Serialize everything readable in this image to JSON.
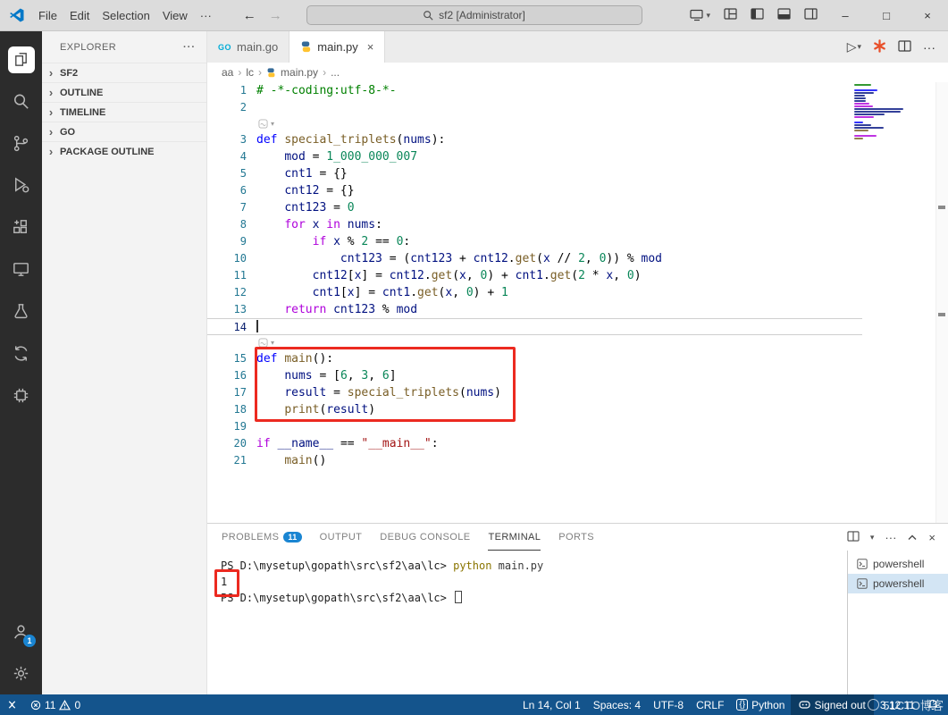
{
  "titlebar": {
    "menus": [
      "File",
      "Edit",
      "Selection",
      "View",
      "···"
    ],
    "search_text": "sf2 [Administrator]",
    "nav": {
      "back": "←",
      "forward": "→"
    },
    "window_controls": {
      "minimize": "–",
      "maximize": "□",
      "close": "×"
    }
  },
  "icons": {
    "caret": "▾",
    "more": "···",
    "chevron": "›",
    "breadcrumb_sep": "›",
    "play": "▷",
    "close_tab": "×",
    "close": "×",
    "go_logo": "GO",
    "language_braces": "{}"
  },
  "activity_bar": {
    "account_badge": "1"
  },
  "sidebar": {
    "title": "EXPLORER",
    "sections": [
      "SF2",
      "OUTLINE",
      "TIMELINE",
      "GO",
      "PACKAGE OUTLINE"
    ]
  },
  "editor": {
    "tabs": [
      {
        "label": "main.go",
        "icon": "go-icon"
      },
      {
        "label": "main.py",
        "icon": "python-icon",
        "active": true
      }
    ],
    "breadcrumb": [
      "aa",
      "lc",
      "main.py",
      "..."
    ],
    "cursor_line": 14,
    "lines": [
      {
        "n": 1,
        "tokens": [
          [
            "com",
            "# -*-coding:utf-8-*-"
          ]
        ]
      },
      {
        "n": 2,
        "tokens": []
      },
      {
        "adorn": true
      },
      {
        "n": 3,
        "tokens": [
          [
            "kw",
            "def "
          ],
          [
            "fn",
            "special_triplets"
          ],
          [
            "op",
            "("
          ],
          [
            "var",
            "nums"
          ],
          [
            "op",
            "):"
          ]
        ]
      },
      {
        "n": 4,
        "tokens": [
          [
            "txt",
            "    "
          ],
          [
            "var",
            "mod"
          ],
          [
            "op",
            " = "
          ],
          [
            "num",
            "1_000_000_007"
          ]
        ]
      },
      {
        "n": 5,
        "tokens": [
          [
            "txt",
            "    "
          ],
          [
            "var",
            "cnt1"
          ],
          [
            "op",
            " = {}"
          ]
        ]
      },
      {
        "n": 6,
        "tokens": [
          [
            "txt",
            "    "
          ],
          [
            "var",
            "cnt12"
          ],
          [
            "op",
            " = {}"
          ]
        ]
      },
      {
        "n": 7,
        "tokens": [
          [
            "txt",
            "    "
          ],
          [
            "var",
            "cnt123"
          ],
          [
            "op",
            " = "
          ],
          [
            "num",
            "0"
          ]
        ]
      },
      {
        "n": 8,
        "tokens": [
          [
            "txt",
            "    "
          ],
          [
            "ctrl",
            "for"
          ],
          [
            "var",
            " x "
          ],
          [
            "ctrl",
            "in"
          ],
          [
            "var",
            " nums"
          ],
          [
            "op",
            ":"
          ]
        ]
      },
      {
        "n": 9,
        "tokens": [
          [
            "txt",
            "        "
          ],
          [
            "ctrl",
            "if"
          ],
          [
            "var",
            " x "
          ],
          [
            "op",
            "% "
          ],
          [
            "num",
            "2"
          ],
          [
            "op",
            " == "
          ],
          [
            "num",
            "0"
          ],
          [
            "op",
            ":"
          ]
        ]
      },
      {
        "n": 10,
        "tokens": [
          [
            "txt",
            "            "
          ],
          [
            "var",
            "cnt123"
          ],
          [
            "op",
            " = ("
          ],
          [
            "var",
            "cnt123"
          ],
          [
            "op",
            " + "
          ],
          [
            "var",
            "cnt12"
          ],
          [
            "op",
            "."
          ],
          [
            "fn",
            "get"
          ],
          [
            "op",
            "("
          ],
          [
            "var",
            "x"
          ],
          [
            "op",
            " // "
          ],
          [
            "num",
            "2"
          ],
          [
            "op",
            ", "
          ],
          [
            "num",
            "0"
          ],
          [
            "op",
            ")) % "
          ],
          [
            "var",
            "mod"
          ]
        ]
      },
      {
        "n": 11,
        "tokens": [
          [
            "txt",
            "        "
          ],
          [
            "var",
            "cnt12"
          ],
          [
            "op",
            "["
          ],
          [
            "var",
            "x"
          ],
          [
            "op",
            "] = "
          ],
          [
            "var",
            "cnt12"
          ],
          [
            "op",
            "."
          ],
          [
            "fn",
            "get"
          ],
          [
            "op",
            "("
          ],
          [
            "var",
            "x"
          ],
          [
            "op",
            ", "
          ],
          [
            "num",
            "0"
          ],
          [
            "op",
            ") + "
          ],
          [
            "var",
            "cnt1"
          ],
          [
            "op",
            "."
          ],
          [
            "fn",
            "get"
          ],
          [
            "op",
            "("
          ],
          [
            "num",
            "2"
          ],
          [
            "op",
            " * "
          ],
          [
            "var",
            "x"
          ],
          [
            "op",
            ", "
          ],
          [
            "num",
            "0"
          ],
          [
            "op",
            ")"
          ]
        ]
      },
      {
        "n": 12,
        "tokens": [
          [
            "txt",
            "        "
          ],
          [
            "var",
            "cnt1"
          ],
          [
            "op",
            "["
          ],
          [
            "var",
            "x"
          ],
          [
            "op",
            "] = "
          ],
          [
            "var",
            "cnt1"
          ],
          [
            "op",
            "."
          ],
          [
            "fn",
            "get"
          ],
          [
            "op",
            "("
          ],
          [
            "var",
            "x"
          ],
          [
            "op",
            ", "
          ],
          [
            "num",
            "0"
          ],
          [
            "op",
            ") + "
          ],
          [
            "num",
            "1"
          ]
        ]
      },
      {
        "n": 13,
        "tokens": [
          [
            "txt",
            "    "
          ],
          [
            "ctrl",
            "return"
          ],
          [
            "var",
            " cnt123 "
          ],
          [
            "op",
            "% "
          ],
          [
            "var",
            "mod"
          ]
        ]
      },
      {
        "n": 14,
        "tokens": []
      },
      {
        "adorn": true
      },
      {
        "n": 15,
        "tokens": [
          [
            "kw",
            "def "
          ],
          [
            "fn",
            "main"
          ],
          [
            "op",
            "():"
          ]
        ]
      },
      {
        "n": 16,
        "tokens": [
          [
            "txt",
            "    "
          ],
          [
            "var",
            "nums"
          ],
          [
            "op",
            " = ["
          ],
          [
            "num",
            "6"
          ],
          [
            "op",
            ", "
          ],
          [
            "num",
            "3"
          ],
          [
            "op",
            ", "
          ],
          [
            "num",
            "6"
          ],
          [
            "op",
            "]"
          ]
        ]
      },
      {
        "n": 17,
        "tokens": [
          [
            "txt",
            "    "
          ],
          [
            "var",
            "result"
          ],
          [
            "op",
            " = "
          ],
          [
            "fn",
            "special_triplets"
          ],
          [
            "op",
            "("
          ],
          [
            "var",
            "nums"
          ],
          [
            "op",
            ")"
          ]
        ]
      },
      {
        "n": 18,
        "tokens": [
          [
            "txt",
            "    "
          ],
          [
            "fn",
            "print"
          ],
          [
            "op",
            "("
          ],
          [
            "var",
            "result"
          ],
          [
            "op",
            ")"
          ]
        ]
      },
      {
        "n": 19,
        "tokens": []
      },
      {
        "n": 20,
        "tokens": [
          [
            "ctrl",
            "if"
          ],
          [
            "var",
            " __name__ "
          ],
          [
            "op",
            "== "
          ],
          [
            "str",
            "\"__main__\""
          ],
          [
            "op",
            ":"
          ]
        ]
      },
      {
        "n": 21,
        "tokens": [
          [
            "txt",
            "    "
          ],
          [
            "fn",
            "main"
          ],
          [
            "op",
            "()"
          ]
        ]
      }
    ]
  },
  "panel": {
    "tabs": [
      {
        "label": "PROBLEMS",
        "badge": "11"
      },
      {
        "label": "OUTPUT"
      },
      {
        "label": "DEBUG CONSOLE"
      },
      {
        "label": "TERMINAL",
        "active": true
      },
      {
        "label": "PORTS"
      }
    ],
    "terminal": {
      "lines": [
        {
          "tokens": [
            [
              "prompt",
              "PS D:\\mysetup\\gopath\\src\\sf2\\aa\\lc> "
            ],
            [
              "cmd",
              "python"
            ],
            [
              "arg",
              " main.py"
            ]
          ]
        },
        {
          "tokens": [
            [
              "out",
              "1"
            ]
          ]
        },
        {
          "tokens": [
            [
              "prompt",
              "PS D:\\mysetup\\gopath\\src\\sf2\\aa\\lc> "
            ]
          ],
          "cursor": true
        }
      ],
      "list": [
        {
          "label": "powershell"
        },
        {
          "label": "powershell",
          "selected": true
        }
      ]
    }
  },
  "status_bar": {
    "errors": "11",
    "warnings": "0",
    "line_col": "Ln 14, Col 1",
    "indent": "Spaces: 4",
    "encoding": "UTF-8",
    "eol": "CRLF",
    "language": "Python",
    "copilot": "Signed out",
    "py_version": "3.12.11"
  },
  "watermark": "51CTO博客",
  "colors": {
    "statusbar": "#14548c",
    "statusbar_dark": "#0c3b63",
    "badge": "#1a85d2",
    "annotation": "#ec2a20",
    "token": {
      "kw": "#0000ff",
      "ctrl": "#af00db",
      "fn": "#795e26",
      "var": "#001080",
      "num": "#098658",
      "str": "#a31515",
      "op": "#000000",
      "com": "#008000",
      "txt": "#000000"
    }
  }
}
